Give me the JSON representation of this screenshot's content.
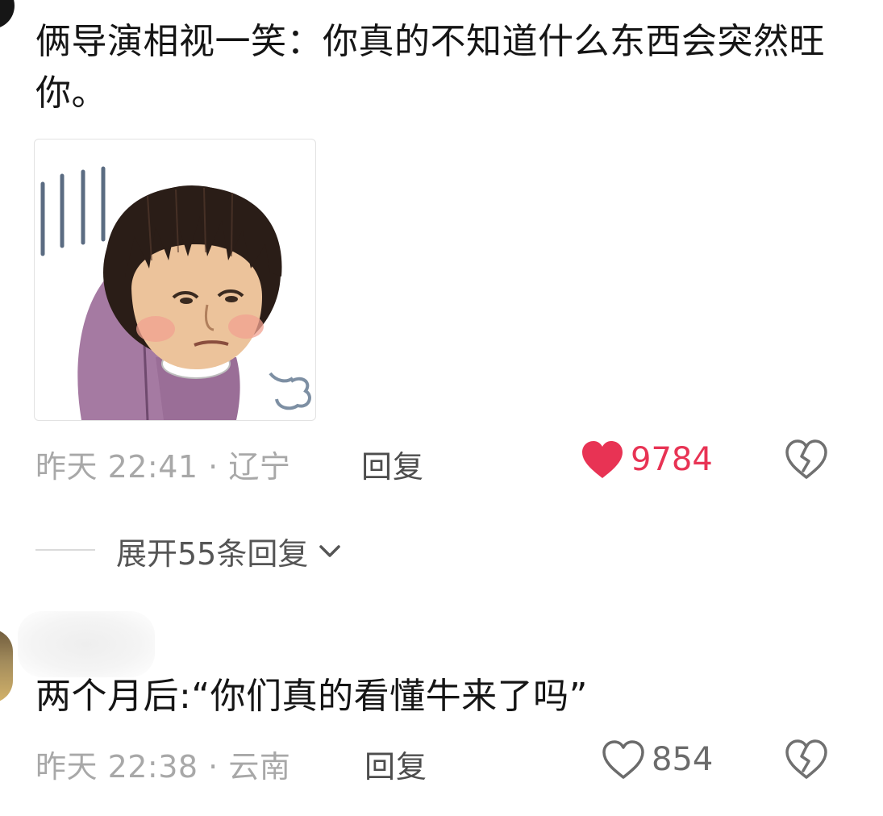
{
  "comments": [
    {
      "text": "俩导演相视一笑：你真的不知道什么东西会突然旺你。",
      "time_location": "昨天 22:41 · 辽宁",
      "reply_label": "回复",
      "like_count": "9784",
      "liked": true,
      "like_icon": "heart-filled-icon",
      "dislike_icon": "broken-heart-icon",
      "sticker": "meme-sticker-icon"
    },
    {
      "text": "两个月后:“你们真的看懂牛来了吗”",
      "time_location": "昨天 22:38 · 云南",
      "reply_label": "回复",
      "like_count": "854",
      "liked": false,
      "like_icon": "heart-outline-icon",
      "dislike_icon": "broken-heart-icon"
    }
  ],
  "expand_replies": {
    "label": "展开55条回复",
    "icon": "chevron-down-icon"
  },
  "colors": {
    "liked": "#e83354",
    "meta_text": "#a8a8a8",
    "reply_text": "#4d4d4d",
    "comment_text": "#151515"
  }
}
